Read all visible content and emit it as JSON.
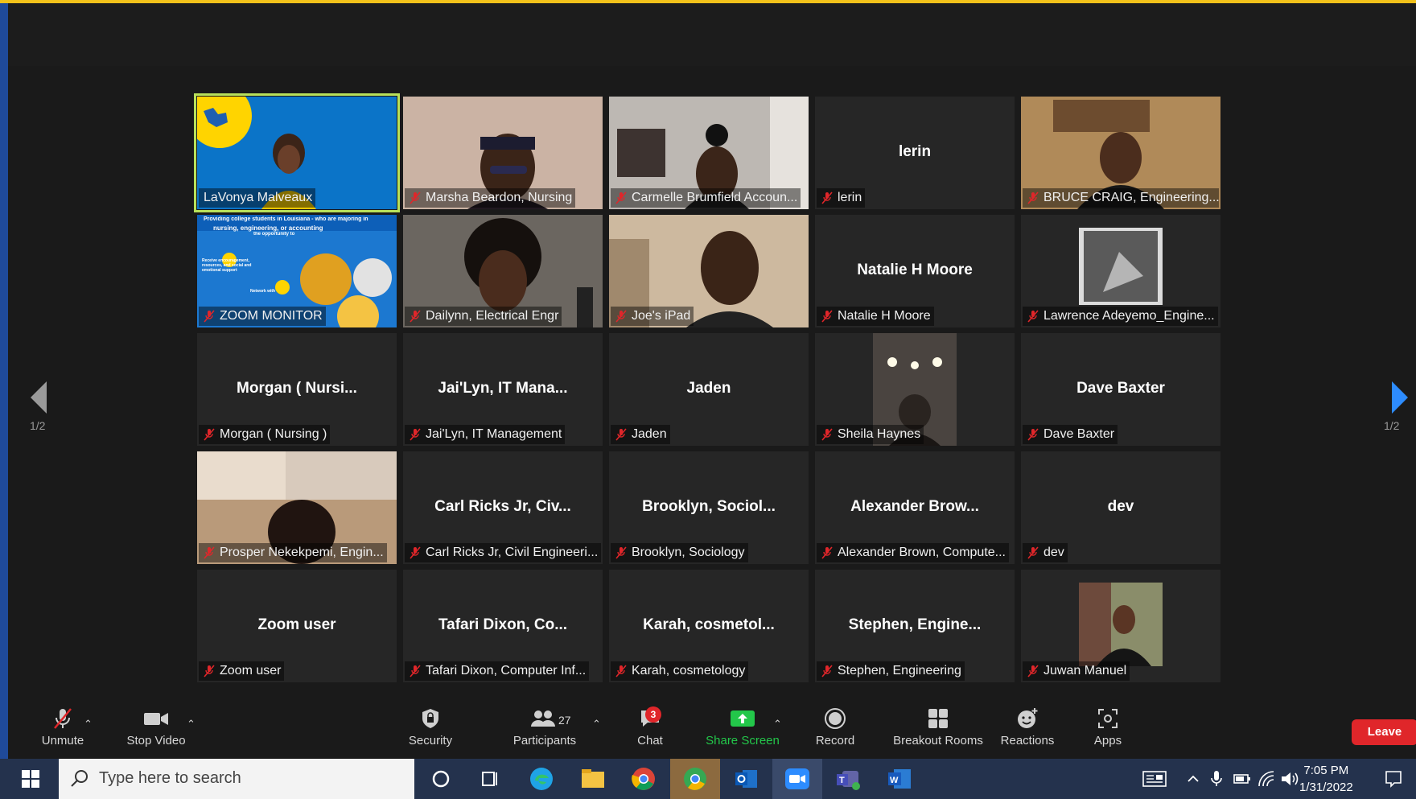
{
  "colors": {
    "accent_active": "#b8e05a",
    "mute_red": "#e0262a",
    "share_green": "#23c74a",
    "nav_blue": "#2d8cff"
  },
  "gallery": {
    "page_left": "1/2",
    "page_right": "1/2",
    "tiles": [
      {
        "caption": "LaVonya Malveaux",
        "big": "",
        "muted": false,
        "video": "banner-lavonya",
        "active": true
      },
      {
        "caption": "Marsha Beardon, Nursing",
        "big": "",
        "muted": true,
        "video": "camera-warm"
      },
      {
        "caption": "Carmelle Brumfield Accoun...",
        "big": "",
        "muted": true,
        "video": "camera-room"
      },
      {
        "caption": "lerin",
        "big": "lerin",
        "muted": true,
        "video": ""
      },
      {
        "caption": "BRUCE CRAIG, Engineering...",
        "big": "",
        "muted": true,
        "video": "camera-wood"
      },
      {
        "caption": "ZOOM MONITOR",
        "big": "",
        "muted": true,
        "video": "flyer",
        "flyer_text": [
          "Providing college students in Louisiana - who are majoring in",
          "nursing, engineering, or accounting",
          "the opportunity to",
          "Receive encouragement, resources, and social and emotional support",
          "Network with"
        ]
      },
      {
        "caption": "Dailynn, Electrical Engr",
        "big": "",
        "muted": true,
        "video": "camera-dim"
      },
      {
        "caption": "Joe's iPad",
        "big": "",
        "muted": true,
        "video": "camera-beige"
      },
      {
        "caption": "Natalie H Moore",
        "big": "Natalie H Moore",
        "muted": true,
        "video": ""
      },
      {
        "caption": "Lawrence Adeyemo_Engine...",
        "big": "",
        "muted": true,
        "video": "avatar-statue"
      },
      {
        "caption": "Morgan ( Nursing )",
        "big": "Morgan ( Nursi...",
        "muted": true,
        "video": ""
      },
      {
        "caption": "Jai'Lyn, IT Management",
        "big": "Jai'Lyn, IT Mana...",
        "muted": true,
        "video": ""
      },
      {
        "caption": "Jaden",
        "big": "Jaden",
        "muted": true,
        "video": ""
      },
      {
        "caption": "Sheila Haynes",
        "big": "",
        "muted": true,
        "video": "avatar-lights"
      },
      {
        "caption": "Dave Baxter",
        "big": "Dave Baxter",
        "muted": true,
        "video": ""
      },
      {
        "caption": "Prosper Nekekpemi, Engin...",
        "big": "",
        "muted": true,
        "video": "camera-room2"
      },
      {
        "caption": "Carl Ricks Jr, Civil Engineeri...",
        "big": "Carl Ricks Jr, Civ...",
        "muted": true,
        "video": ""
      },
      {
        "caption": "Brooklyn, Sociology",
        "big": "Brooklyn, Sociol...",
        "muted": true,
        "video": ""
      },
      {
        "caption": "Alexander Brown, Compute...",
        "big": "Alexander Brow...",
        "muted": true,
        "video": ""
      },
      {
        "caption": "dev",
        "big": "dev",
        "muted": true,
        "video": ""
      },
      {
        "caption": "Zoom user",
        "big": "Zoom user",
        "muted": true,
        "video": ""
      },
      {
        "caption": "Tafari Dixon, Computer Inf...",
        "big": "Tafari Dixon, Co...",
        "muted": true,
        "video": ""
      },
      {
        "caption": "Karah, cosmetology",
        "big": "Karah, cosmetol...",
        "muted": true,
        "video": ""
      },
      {
        "caption": "Stephen, Engineering",
        "big": "Stephen, Engine...",
        "muted": true,
        "video": ""
      },
      {
        "caption": "Juwan Manuel",
        "big": "",
        "muted": true,
        "video": "avatar-photo"
      }
    ]
  },
  "toolbar": {
    "unmute": "Unmute",
    "stop_video": "Stop Video",
    "security": "Security",
    "participants": "Participants",
    "participants_count": "27",
    "chat": "Chat",
    "chat_badge": "3",
    "share_screen": "Share Screen",
    "record": "Record",
    "breakout_rooms": "Breakout Rooms",
    "reactions": "Reactions",
    "apps": "Apps",
    "leave": "Leave"
  },
  "taskbar": {
    "search_placeholder": "Type here to search",
    "time": "7:05 PM",
    "date": "1/31/2022",
    "icons": [
      "windows-start-icon",
      "search-icon",
      "cortana-icon",
      "task-view-icon",
      "edge-icon",
      "file-explorer-icon",
      "chrome-icon",
      "chrome-alt-icon",
      "outlook-icon",
      "zoom-icon",
      "teams-icon",
      "word-icon"
    ]
  }
}
